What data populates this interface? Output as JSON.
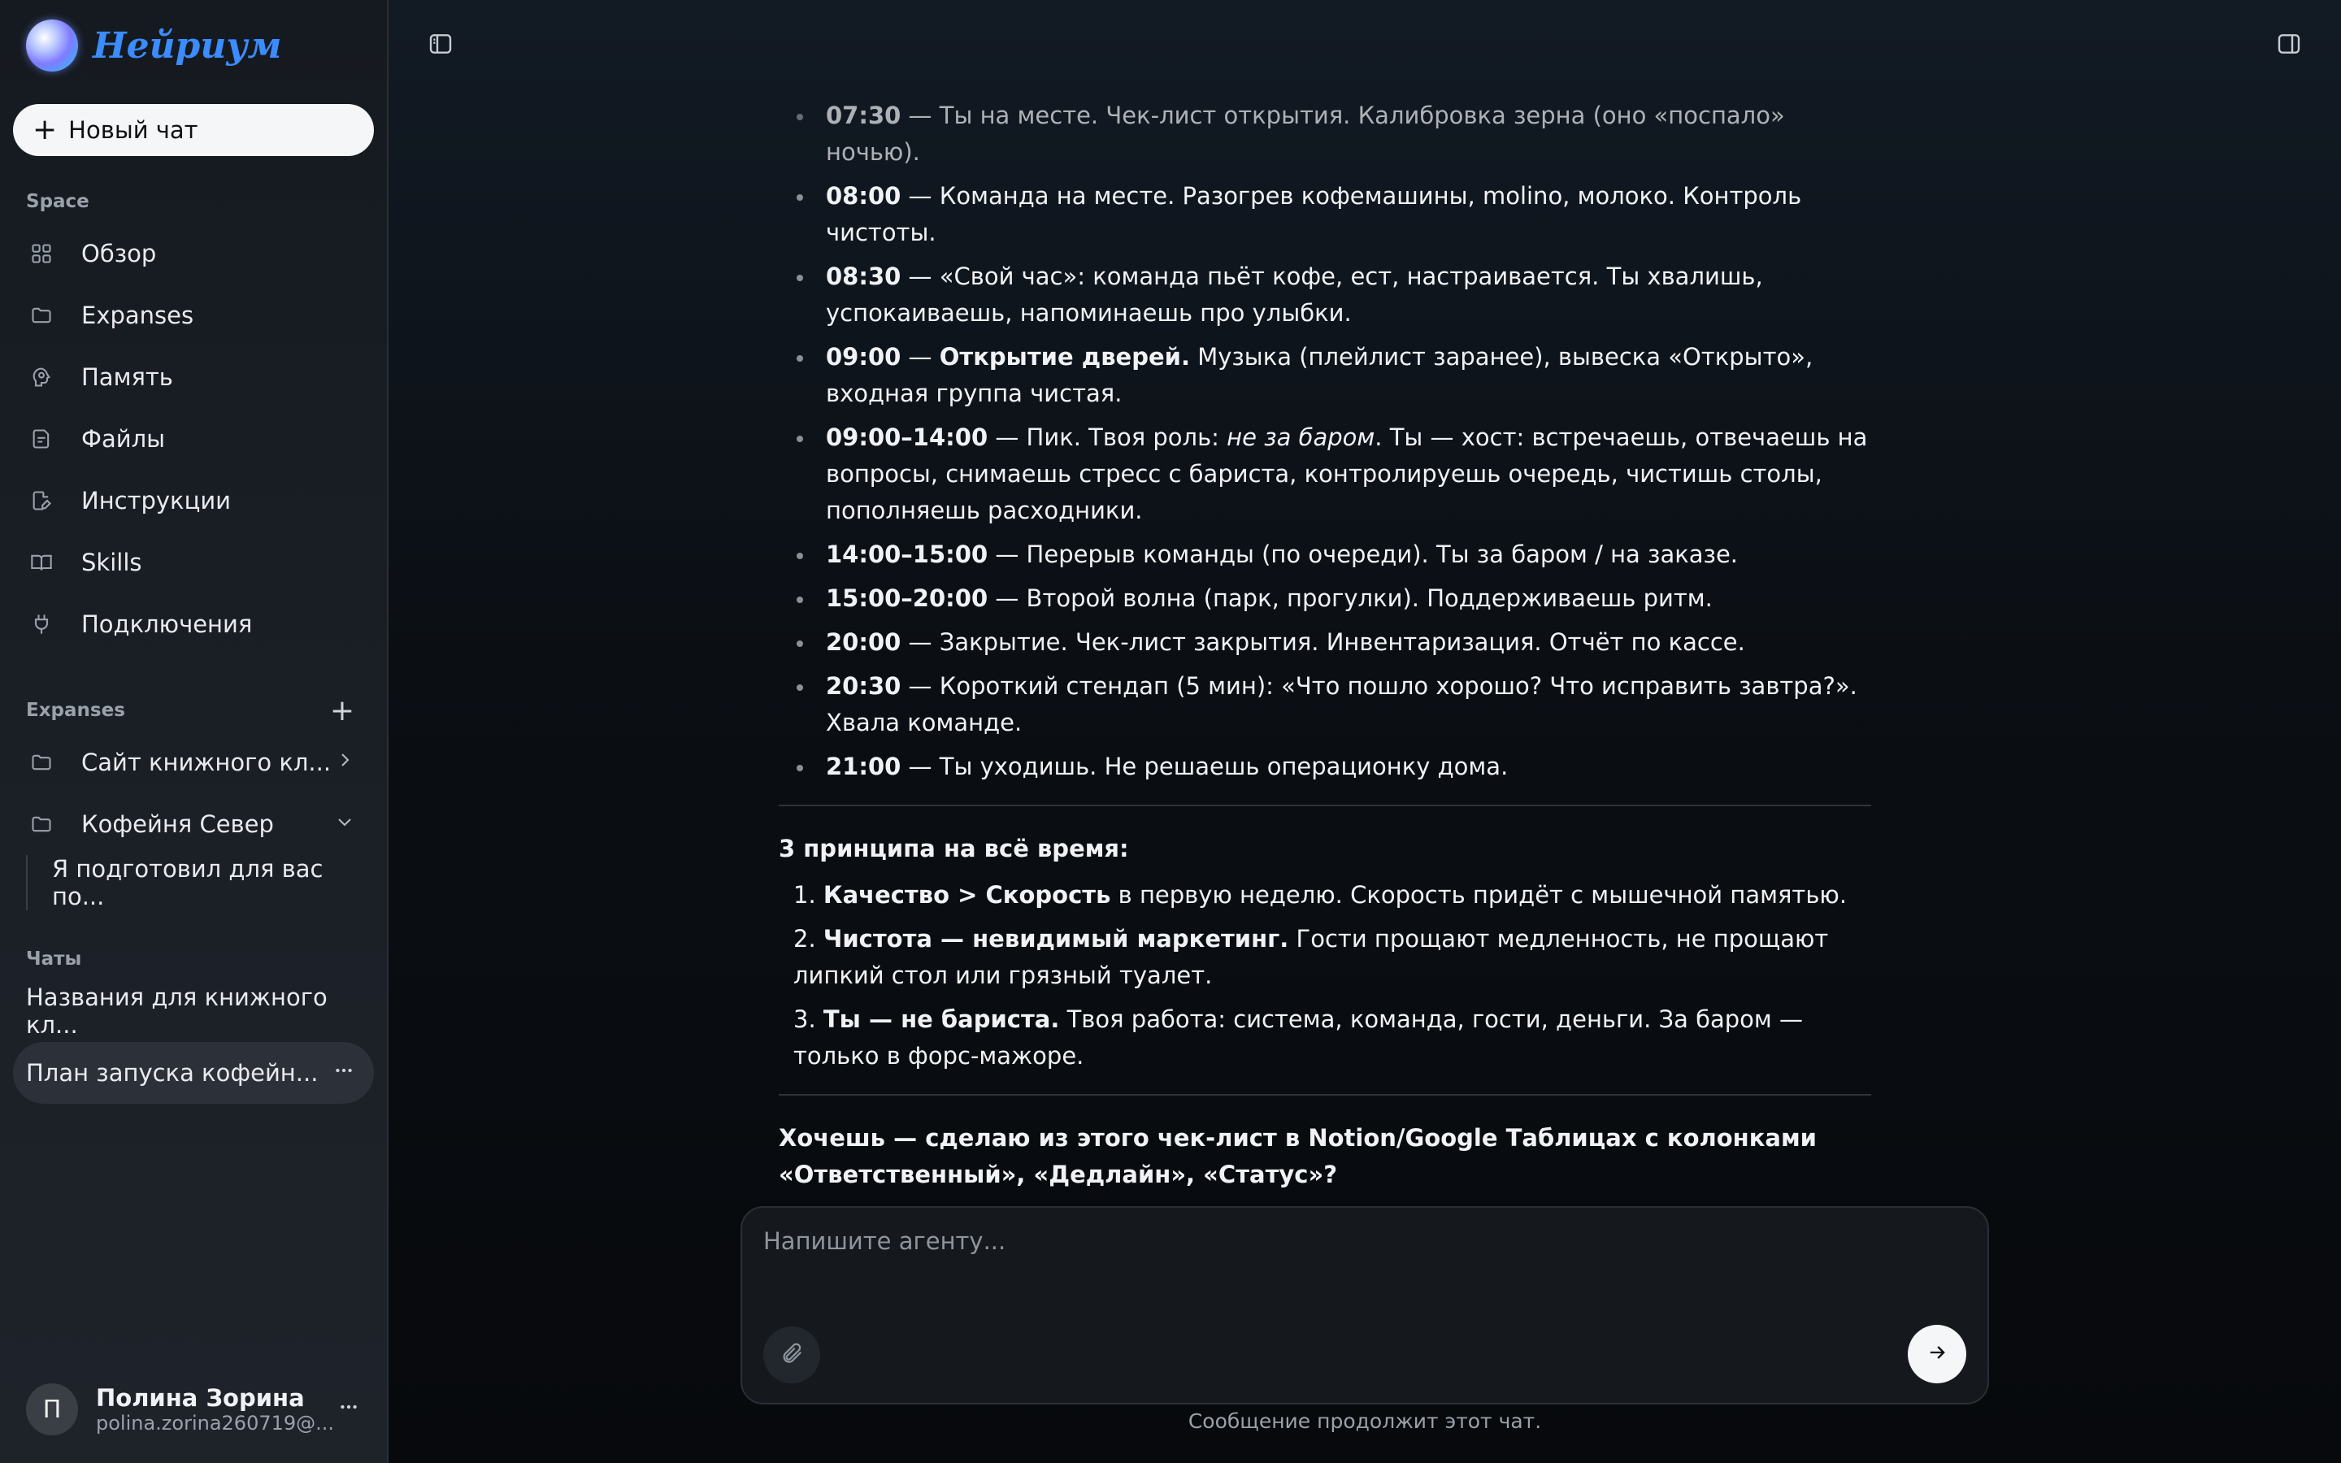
{
  "brand": {
    "name": "Нейриум"
  },
  "new_chat_label": "Новый чат",
  "space": {
    "label": "Space",
    "items": [
      {
        "label": "Обзор",
        "icon": "grid-icon"
      },
      {
        "label": "Expanses",
        "icon": "folder-icon"
      },
      {
        "label": "Память",
        "icon": "brain-icon"
      },
      {
        "label": "Файлы",
        "icon": "file-icon"
      },
      {
        "label": "Инструкции",
        "icon": "edit-file-icon"
      },
      {
        "label": "Skills",
        "icon": "book-icon"
      },
      {
        "label": "Подключения",
        "icon": "plug-icon"
      }
    ]
  },
  "expanses": {
    "label": "Expanses",
    "items": [
      {
        "label": "Сайт книжного кл..."
      },
      {
        "label": "Кофейня Север"
      }
    ],
    "sub_item": "Я подготовил для вас по..."
  },
  "chats": {
    "label": "Чаты",
    "items": [
      {
        "label": "Названия для книжного кл..."
      },
      {
        "label": "План запуска кофейн..."
      }
    ]
  },
  "user": {
    "initial": "П",
    "name": "Полина Зорина",
    "email": "polina.zorina260719@..."
  },
  "message": {
    "schedule": [
      {
        "time": "07:30",
        "text": " — Ты на месте. Чек-лист открытия. Калибровка зерна (оно «поспало» ночью)."
      },
      {
        "time": "08:00",
        "text": " — Команда на месте. Разогрев кофемашины, molino, молоко. Контроль чистоты."
      },
      {
        "time": "08:30",
        "text": " — «Свой час»: команда пьёт кофе, ест, настраивается. Ты хвалишь, успокаиваешь, напоминаешь про улыбки."
      },
      {
        "time": "09:00",
        "text_pre": " — ",
        "strong": "Открытие дверей.",
        "text": " Музыка (плейлист заранее), вывеска «Открыто», входная группа чистая."
      },
      {
        "time": "09:00–14:00",
        "text_pre": " — Пик. Твоя роль: ",
        "em": "не за баром",
        "text": ". Ты — хост: встречаешь, отвечаешь на вопросы, снимаешь стресс с бариста, контролируешь очередь, чистишь столы, пополняешь расходники."
      },
      {
        "time": "14:00–15:00",
        "text": " — Перерыв команды (по очереди). Ты за баром / на заказе."
      },
      {
        "time": "15:00–20:00",
        "text": " — Второй волна (парк, прогулки). Поддерживаешь ритм."
      },
      {
        "time": "20:00",
        "text": " — Закрытие. Чек-лист закрытия. Инвентаризация. Отчёт по кассе."
      },
      {
        "time": "20:30",
        "text": " — Короткий стендап (5 мин): «Что пошло хорошо? Что исправить завтра?». Хвала команде."
      },
      {
        "time": "21:00",
        "text": " — Ты уходишь. Не решаешь операционку дома."
      }
    ],
    "principles_title": "3 принципа на всё время:",
    "principles": [
      {
        "num": "1.",
        "strong": "Качество > Скорость",
        "text": " в первую неделю. Скорость придёт с мышечной памятью."
      },
      {
        "num": "2.",
        "strong": "Чистота — невидимый маркетинг.",
        "text": " Гости прощают медленность, не прощают липкий стол или грязный туалет."
      },
      {
        "num": "3.",
        "strong": "Ты — не бариста.",
        "text": " Твоя работа: система, команда, гости, деньги. За баром — только в форс-мажоре."
      }
    ],
    "final": "Хочешь — сделаю из этого чек-лист в Notion/Google Таблицах с колонками «Ответственный», «Дедлайн», «Статус»?"
  },
  "composer": {
    "placeholder": "Напишите агенту...",
    "hint": "Сообщение продолжит этот чат."
  }
}
